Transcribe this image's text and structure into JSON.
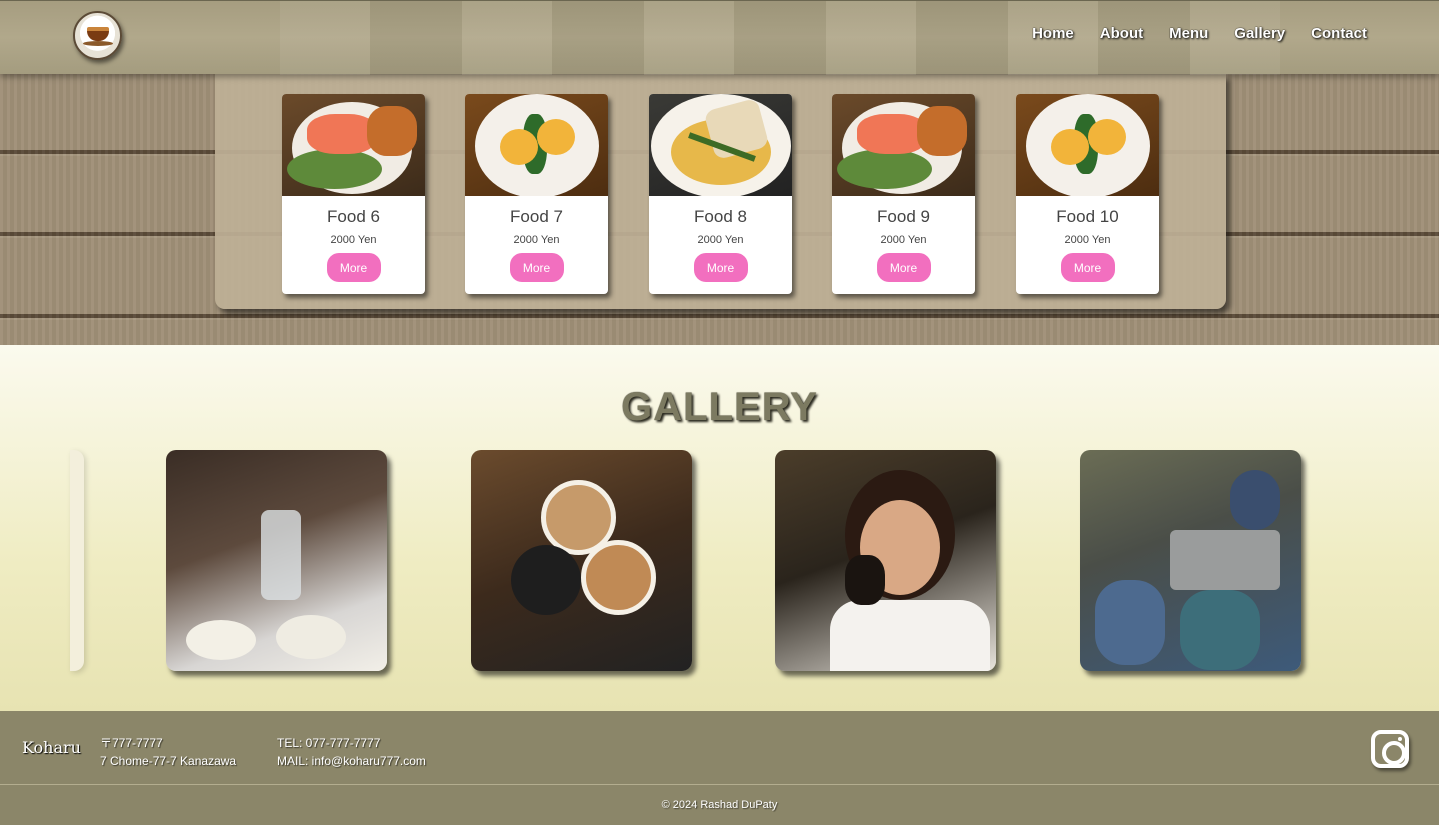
{
  "header": {
    "logo_icon": "coffee-cup-icon",
    "nav": [
      "Home",
      "About",
      "Menu",
      "Gallery",
      "Contact"
    ]
  },
  "menu": {
    "items": [
      {
        "name": "Food 6",
        "price": "2000 Yen",
        "button": "More",
        "image": "salmon-plate"
      },
      {
        "name": "Food 7",
        "price": "2000 Yen",
        "button": "More",
        "image": "eggs-benedict"
      },
      {
        "name": "Food 8",
        "price": "2000 Yen",
        "button": "More",
        "image": "fish-dish"
      },
      {
        "name": "Food 9",
        "price": "2000 Yen",
        "button": "More",
        "image": "salmon-plate"
      },
      {
        "name": "Food 10",
        "price": "2000 Yen",
        "button": "More",
        "image": "eggs-benedict"
      }
    ],
    "accent_color": "#f26fbf"
  },
  "gallery": {
    "title": "GALLERY",
    "photos": [
      "coffee-brewing-photo",
      "latte-toast-photo",
      "woman-drinking-photo",
      "barista-counter-photo"
    ]
  },
  "footer": {
    "brand": "Koharu",
    "postal": "〒777-7777",
    "address": "7 Chome-77-7 Kanazawa",
    "tel": "TEL: 077-777-7777",
    "mail": "MAIL: info@koharu777.com",
    "social_icon": "instagram-icon",
    "copyright": "© 2024 Rashad DuPaty"
  }
}
